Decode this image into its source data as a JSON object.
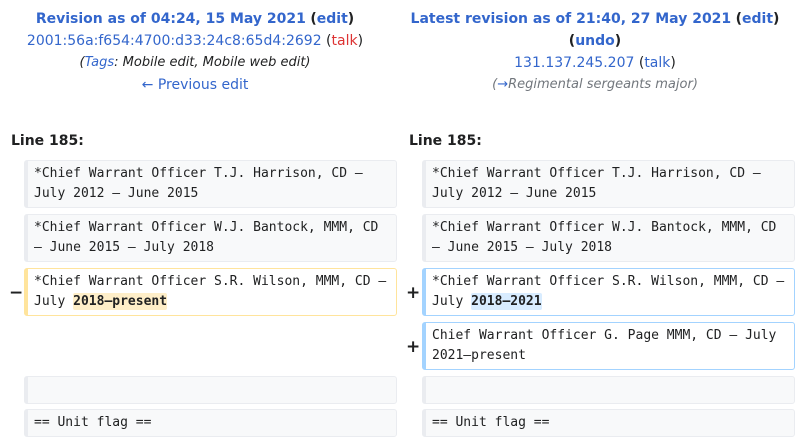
{
  "left_header": {
    "title": "Revision as of 04:24, 15 May 2021",
    "edit": "edit",
    "user": "2001:56a:f654:4700:d33:24c8:65d4:2692",
    "talk": "talk",
    "tags_label": "Tags",
    "tags_value": ": Mobile edit, Mobile web edit",
    "prev_edit": "← Previous edit"
  },
  "right_header": {
    "title": "Latest revision as of 21:40, 27 May 2021",
    "edit": "edit",
    "undo": "undo",
    "user": "131.137.245.207",
    "talk": "talk",
    "summary_arrow": "→",
    "summary": "Regimental sergeants major"
  },
  "line_label": "Line 185:",
  "rows": {
    "r1": "*Chief Warrant Officer T.J. Harrison, CD – July 2012 – June 2015",
    "r2": "*Chief Warrant Officer W.J. Bantock, MMM, CD – June 2015 – July 2018",
    "r3_left_pre": "*Chief Warrant Officer S.R. Wilson, MMM, CD – July ",
    "r3_left_hl": "2018–present",
    "r3_right_pre": "*Chief Warrant Officer S.R. Wilson, MMM, CD – July ",
    "r3_right_hl": "2018–2021",
    "r4_right": "Chief Warrant Officer  G.  Page MMM, CD – July 2021–present",
    "r6": "== Unit flag =="
  },
  "markers": {
    "minus": "−",
    "plus": "+"
  },
  "colors": {
    "link": "#3366cc",
    "red_link": "#dd3333",
    "deleted_border": "#ffe49c",
    "added_border": "#a3d3ff",
    "deleted_hl": "#feeec8",
    "added_hl": "#d8ecff"
  }
}
